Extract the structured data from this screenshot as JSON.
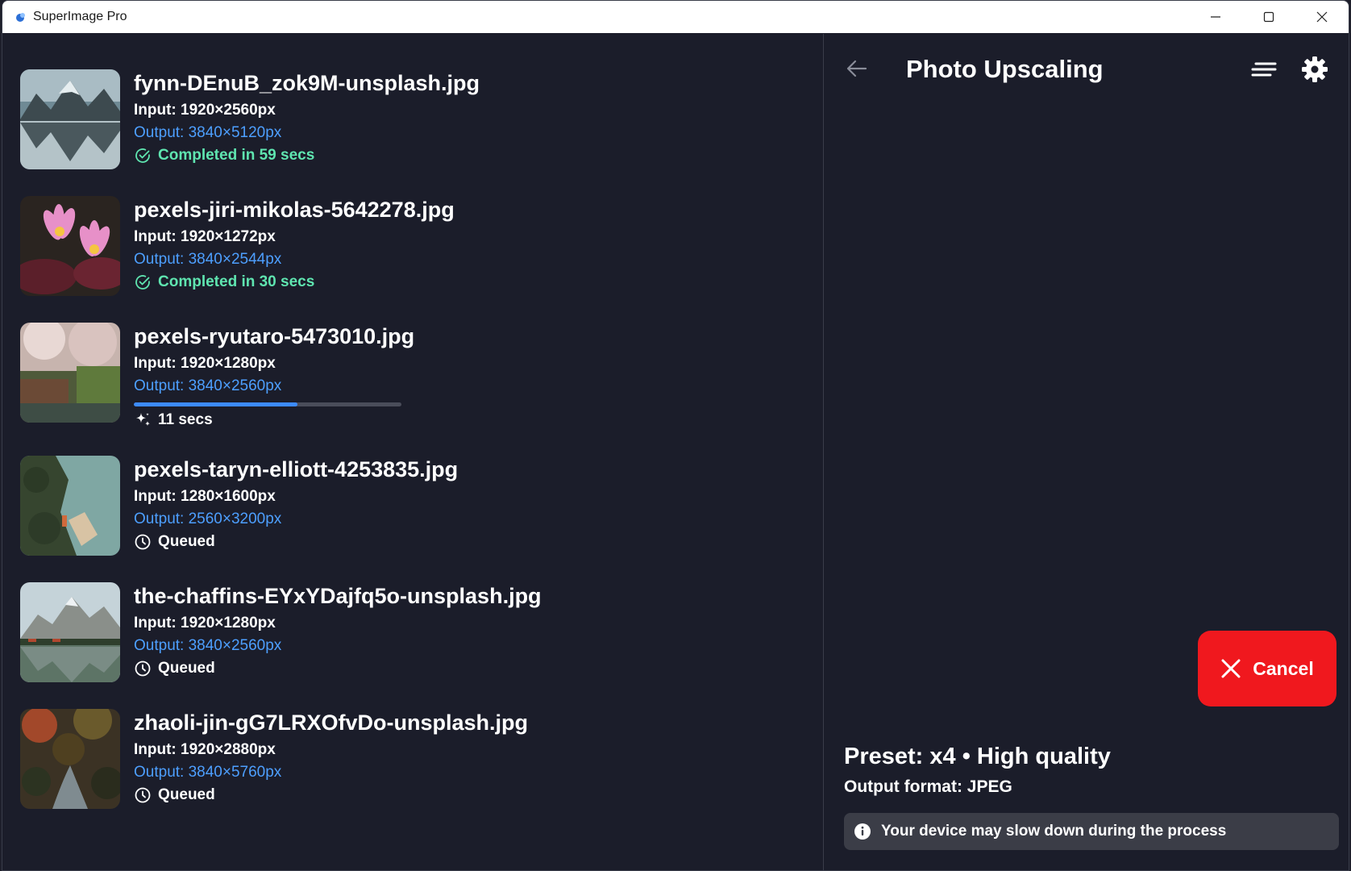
{
  "window": {
    "title": "SuperImage Pro"
  },
  "items": [
    {
      "name": "fynn-DEnuB_zok9M-unsplash.jpg",
      "input": "Input: 1920×2560px",
      "output": "Output: 3840×5120px",
      "status_type": "done",
      "status_text": "Completed in 59 secs"
    },
    {
      "name": "pexels-jiri-mikolas-5642278.jpg",
      "input": "Input: 1920×1272px",
      "output": "Output: 3840×2544px",
      "status_type": "done",
      "status_text": "Completed in 30 secs"
    },
    {
      "name": "pexels-ryutaro-5473010.jpg",
      "input": "Input: 1920×1280px",
      "output": "Output: 3840×2560px",
      "status_type": "running",
      "progress": 0.61,
      "status_text": "11 secs"
    },
    {
      "name": "pexels-taryn-elliott-4253835.jpg",
      "input": "Input: 1280×1600px",
      "output": "Output: 2560×3200px",
      "status_type": "queued",
      "status_text": "Queued"
    },
    {
      "name": "the-chaffins-EYxYDajfq5o-unsplash.jpg",
      "input": "Input: 1920×1280px",
      "output": "Output: 3840×2560px",
      "status_type": "queued",
      "status_text": "Queued"
    },
    {
      "name": "zhaoli-jin-gG7LRXOfvDo-unsplash.jpg",
      "input": "Input: 1920×2880px",
      "output": "Output: 3840×5760px",
      "status_type": "queued",
      "status_text": "Queued"
    }
  ],
  "panel": {
    "title": "Photo Upscaling",
    "cancel_label": "Cancel",
    "preset": "Preset: x4 • High quality",
    "output_format": "Output format: JPEG",
    "notice": "Your device may slow down during the process"
  },
  "colors": {
    "accent_blue": "#4d9fff",
    "success_green": "#5fe5b0",
    "cancel_red": "#f0181e",
    "background": "#1b1d2a"
  },
  "icons": {
    "done": "check-circle-icon",
    "running": "sparkle-icon",
    "queued": "clock-icon"
  }
}
